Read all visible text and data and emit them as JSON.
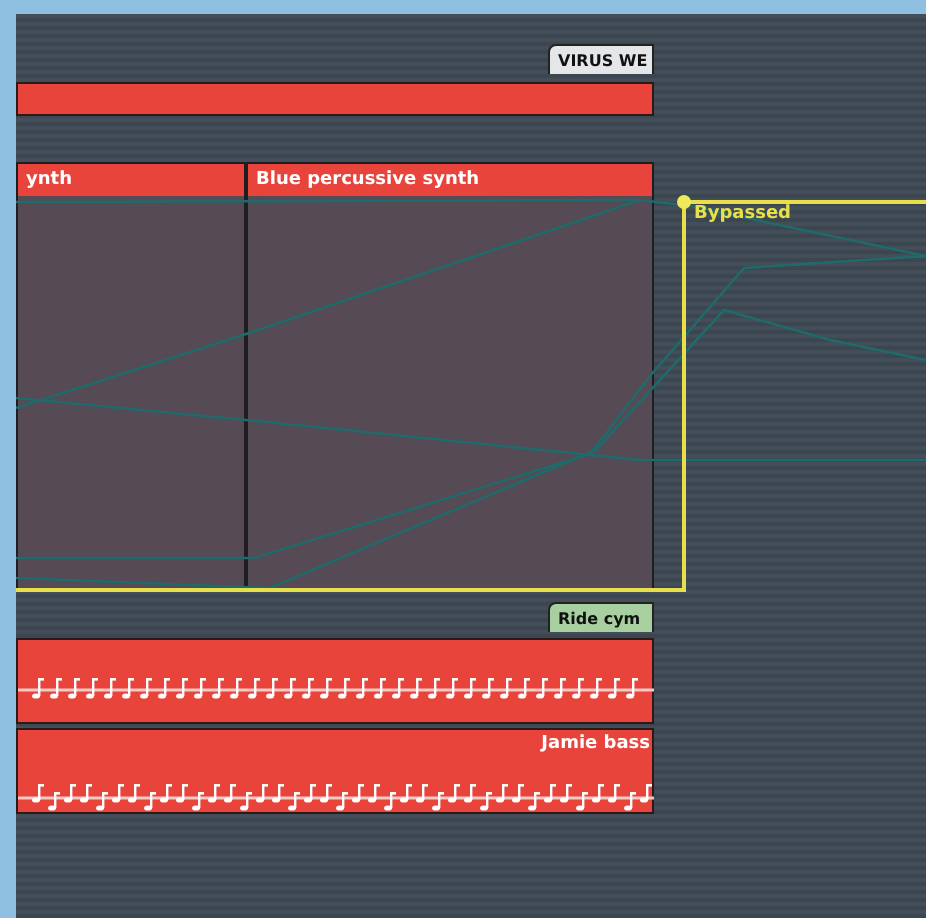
{
  "top_track": {
    "tab_label": "VIRUS WE"
  },
  "synth_regions": [
    {
      "name": "ynth"
    },
    {
      "name": "Blue percussive synth"
    }
  ],
  "automation": {
    "label": "Bypassed"
  },
  "drum_track": {
    "tab_label": "Ride cym"
  },
  "bass_region": {
    "name": "Jamie bass"
  }
}
